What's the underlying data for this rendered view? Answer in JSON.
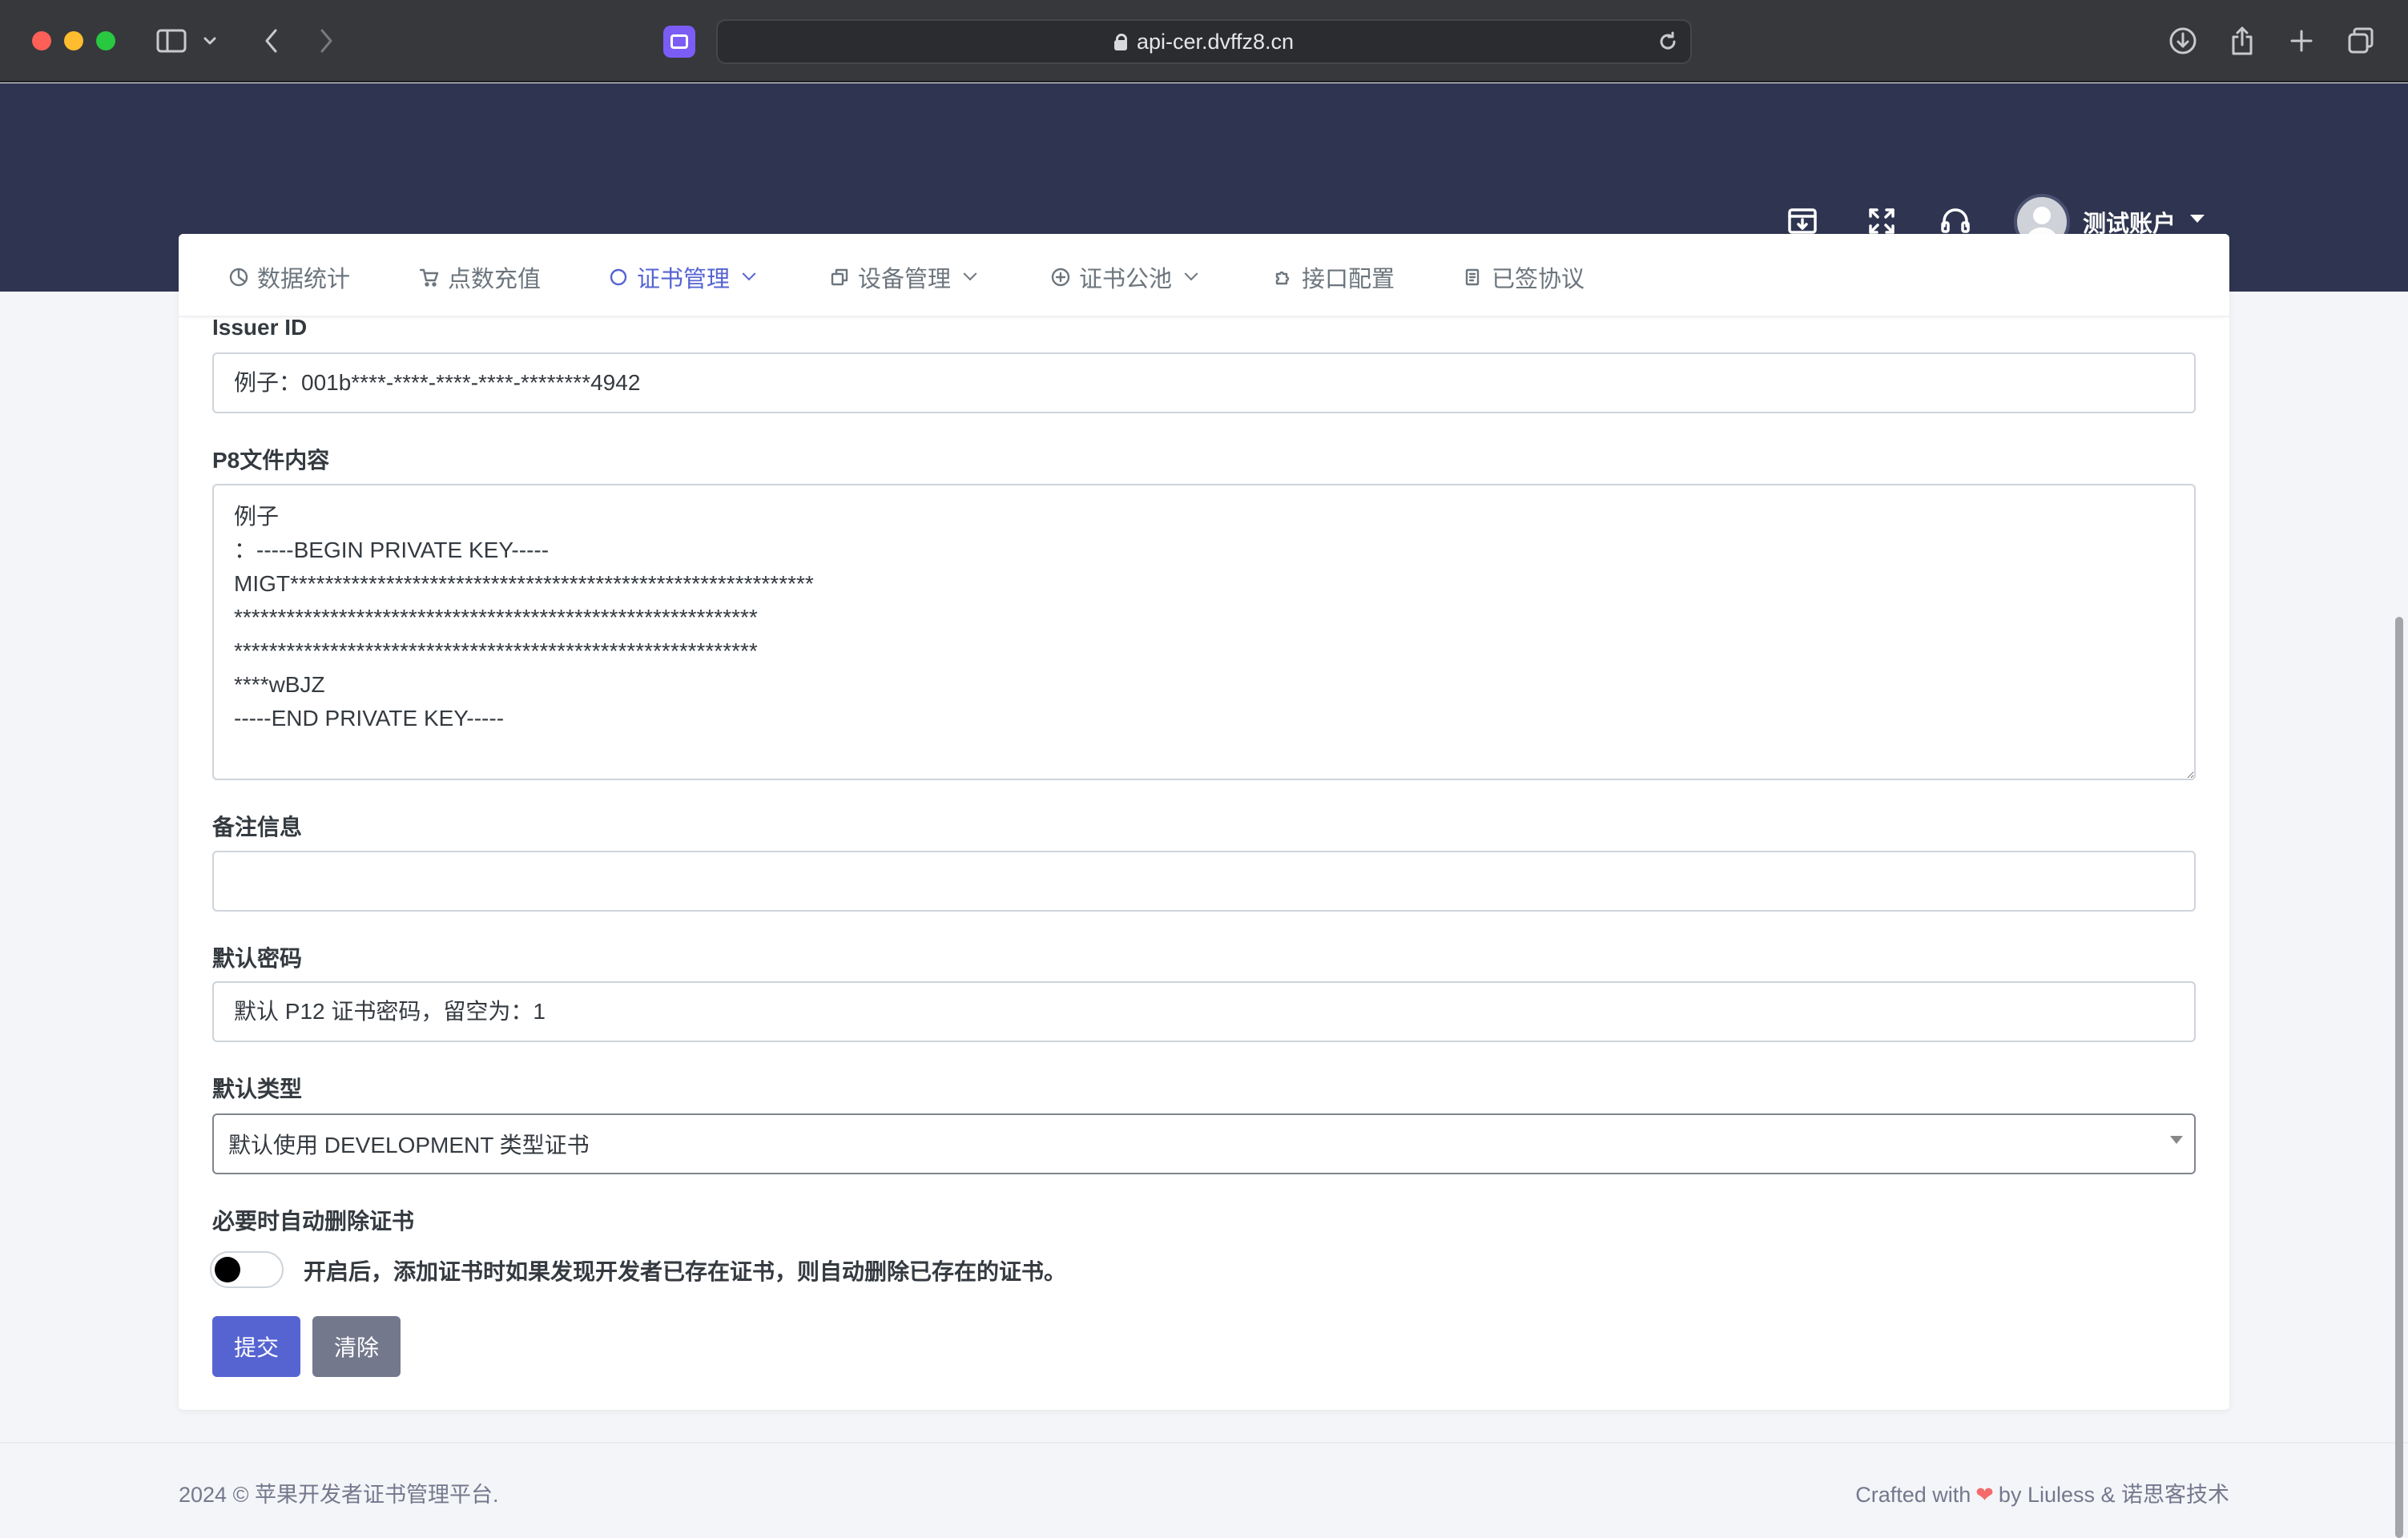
{
  "browser": {
    "url": "api-cer.dvffz8.cn"
  },
  "header": {
    "user_name": "测试账户"
  },
  "nav": {
    "items": [
      {
        "label": "数据统计",
        "icon": "pie-chart-icon"
      },
      {
        "label": "点数充值",
        "icon": "cart-icon"
      },
      {
        "label": "证书管理",
        "icon": "circle-icon",
        "active": true,
        "dropdown": true
      },
      {
        "label": "设备管理",
        "icon": "copy-icon",
        "dropdown": true
      },
      {
        "label": "证书公池",
        "icon": "plus-circle-icon",
        "dropdown": true
      },
      {
        "label": "接口配置",
        "icon": "puzzle-icon"
      },
      {
        "label": "已签协议",
        "icon": "document-icon"
      }
    ]
  },
  "form": {
    "issuer_label": "Issuer ID",
    "issuer_placeholder": "例子：001b****-****-****-****-********4942",
    "p8_label": "P8文件内容",
    "p8_placeholder": "例子\n：-----BEGIN PRIVATE KEY-----\nMIGT************************************************************\n************************************************************\n************************************************************\n****wBJZ\n-----END PRIVATE KEY-----",
    "remark_label": "备注信息",
    "remark_placeholder": "",
    "password_label": "默认密码",
    "password_placeholder": "默认 P12 证书密码，留空为：1",
    "type_label": "默认类型",
    "type_selected": "默认使用 DEVELOPMENT 类型证书",
    "auto_delete_label": "必要时自动删除证书",
    "auto_delete_text": "开启后，添加证书时如果发现开发者已存在证书，则自动删除已存在的证书。",
    "auto_delete_on": false,
    "submit_label": "提交",
    "clear_label": "清除"
  },
  "footer": {
    "copyright": "2024 © 苹果开发者证书管理平台.",
    "crafted_prefix": "Crafted with",
    "crafted_suffix": "by Liuless & 诺思客技术"
  },
  "colors": {
    "header_bg": "#2f3550",
    "primary": "#5664d2",
    "secondary": "#74788d"
  }
}
